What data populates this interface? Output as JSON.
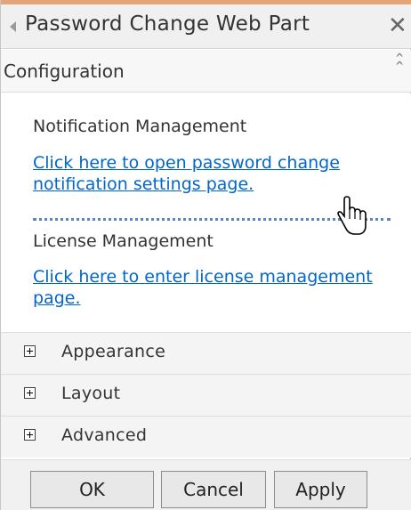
{
  "panel": {
    "title": "Password Change Web Part",
    "close_icon": "close-icon",
    "collapse_icon": "collapse-arrow-icon"
  },
  "configuration": {
    "label": "Configuration",
    "notification": {
      "title": "Notification Management",
      "link": "Click here to open password change notification settings page."
    },
    "license": {
      "title": "License Management",
      "link": "Click here to enter license management page."
    }
  },
  "sections": [
    {
      "label": "Appearance"
    },
    {
      "label": "Layout"
    },
    {
      "label": "Advanced"
    }
  ],
  "buttons": {
    "ok": "OK",
    "cancel": "Cancel",
    "apply": "Apply"
  },
  "colors": {
    "accent_strip": "#e2a679",
    "link": "#0066cc"
  }
}
